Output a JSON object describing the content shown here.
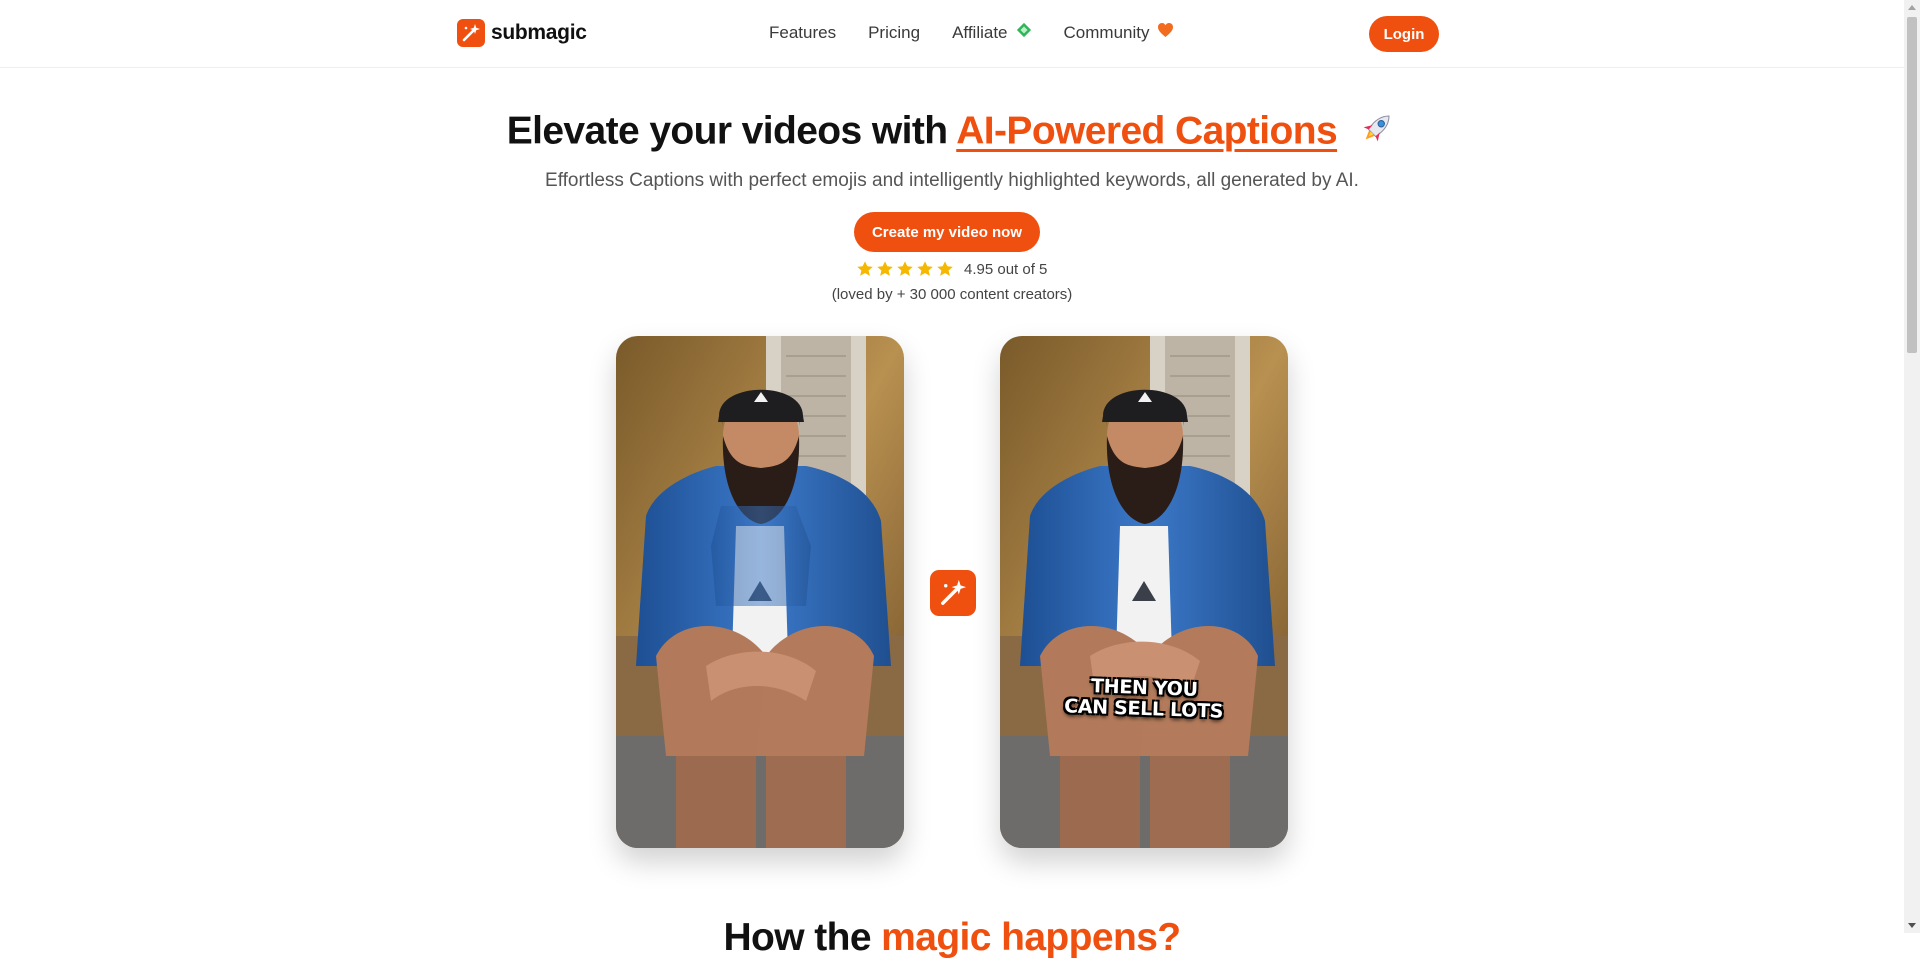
{
  "brand": {
    "name": "submagic",
    "accent_color": "#f0500f"
  },
  "nav": {
    "items": [
      {
        "label": "Features",
        "icon": ""
      },
      {
        "label": "Pricing",
        "icon": ""
      },
      {
        "label": "Affiliate",
        "icon": "money-icon"
      },
      {
        "label": "Community",
        "icon": "heart-icon"
      }
    ],
    "login_label": "Login"
  },
  "hero": {
    "title_prefix": "Elevate your videos with ",
    "title_accent": "AI-Powered Captions",
    "title_emoji": "rocket-icon",
    "subtitle": "Effortless Captions with perfect emojis and intelligently highlighted keywords, all generated by AI.",
    "cta_label": "Create my video now",
    "rating_text": "4.95 out of 5",
    "rating_stars": 5,
    "loved_text": "(loved by + 30 000 content creators)"
  },
  "videos": {
    "after_caption_line1": "THEN YOU",
    "after_caption_line2": "CAN SELL LOTS"
  },
  "next_section": {
    "title_prefix": "How the ",
    "title_accent": "magic happens?"
  }
}
